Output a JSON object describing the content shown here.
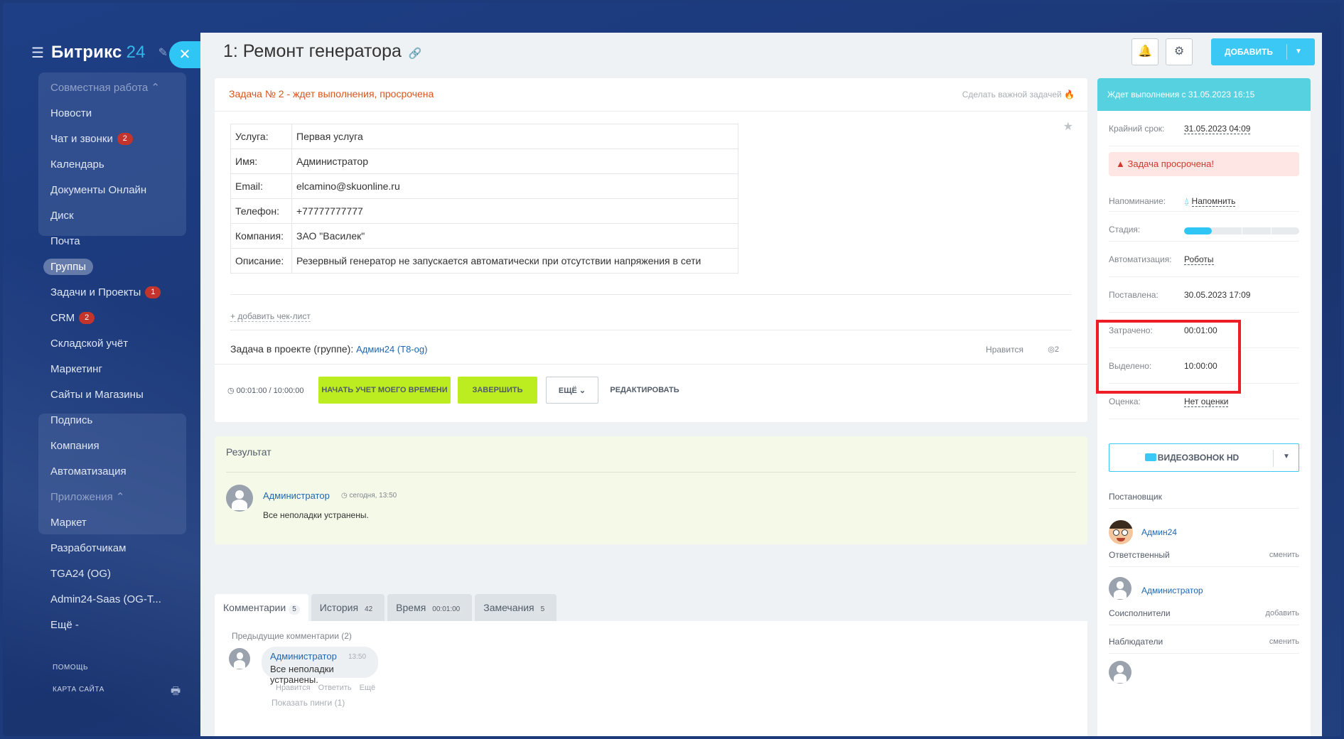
{
  "sidebar": {
    "logo": "Битрикс",
    "logo_num": "24",
    "items": [
      {
        "label": "Совместная работа ⌃",
        "dim": true
      },
      {
        "label": "Новости"
      },
      {
        "label": "Чат и звонки",
        "badge": "2"
      },
      {
        "label": "Календарь"
      },
      {
        "label": "Документы Онлайн"
      },
      {
        "label": "Диск"
      },
      {
        "label": "Почта"
      },
      {
        "label": "Группы",
        "active": true
      },
      {
        "label": "Задачи и Проекты",
        "badge": "1"
      },
      {
        "label": "CRM",
        "badge": "2"
      },
      {
        "label": "Складской учёт"
      },
      {
        "label": "Маркетинг"
      },
      {
        "label": "Сайты и Магазины"
      },
      {
        "label": "Подпись"
      },
      {
        "label": "Компания"
      },
      {
        "label": "Автоматизация"
      },
      {
        "label": "Приложения ⌃",
        "dim": true
      },
      {
        "label": "Маркет"
      },
      {
        "label": "Разработчикам"
      },
      {
        "label": "TGA24 (OG)"
      },
      {
        "label": "Admin24-Saas (OG-T..."
      },
      {
        "label": "Ещё -"
      }
    ],
    "help": "ПОМОЩЬ",
    "sitemap": "КАРТА САЙТА"
  },
  "header": {
    "title": "1: Ремонт генератора",
    "add_label": "ДОБАВИТЬ"
  },
  "task": {
    "status_line": "Задача № 2 - ждет выполнения, просрочена",
    "make_important": "Сделать важной задачей",
    "fields": [
      {
        "k": "Услуга:",
        "v": "Первая услуга"
      },
      {
        "k": "Имя:",
        "v": "Администратор"
      },
      {
        "k": "Email:",
        "v": "elcamino@skuonline.ru"
      },
      {
        "k": "Телефон:",
        "v": "+77777777777"
      },
      {
        "k": "Компания:",
        "v": "ЗАО \"Василек\""
      },
      {
        "k": "Описание:",
        "v": "Резервный генератор не запускается автоматически  при отсутствии напряжения в сети"
      }
    ],
    "add_checklist": "+ добавить чек-лист",
    "in_project": "Задача в проекте (группе):",
    "project_name": "Админ24 (Т8-og)",
    "like": "Нравится",
    "views": "2",
    "timer": "00:01:00 / 10:00:00",
    "btn_start": "НАЧАТЬ УЧЕТ МОЕГО ВРЕМЕНИ",
    "btn_finish": "ЗАВЕРШИТЬ",
    "btn_more": "ЕЩЁ",
    "btn_edit": "РЕДАКТИРОВАТЬ"
  },
  "result": {
    "title": "Результат",
    "author": "Администратор",
    "time": "сегодня, 13:50",
    "text": "Все неполадки устранены."
  },
  "tabs": [
    {
      "label": "Комментарии",
      "count": "5"
    },
    {
      "label": "История",
      "count": "42"
    },
    {
      "label": "Время",
      "count": "00:01:00"
    },
    {
      "label": "Замечания",
      "count": "5"
    }
  ],
  "comments": {
    "prev_label": "Предыдущие комментарии",
    "prev_count": "(2)",
    "author": "Администратор",
    "time": "13:50",
    "text": "Все неполадки устранены.",
    "actions": "Нравится Ответить Ещё",
    "pings": "Показать пинги (1)"
  },
  "right": {
    "status": "Ждет выполнения с 31.05.2023 16:15",
    "deadline_label": "Крайний срок:",
    "deadline": "31.05.2023 04:09",
    "overdue": "Задача просрочена!",
    "reminder_label": "Напоминание:",
    "reminder": "Напомнить",
    "stage_label": "Стадия:",
    "stage_progress": 0.24,
    "automation_label": "Автоматизация:",
    "automation": "Роботы",
    "created_label": "Поставлена:",
    "created": "30.05.2023 17:09",
    "spent_label": "Затрачено:",
    "spent": "00:01:00",
    "allocated_label": "Выделено:",
    "allocated": "10:00:00",
    "rating_label": "Оценка:",
    "rating": "Нет оценки",
    "video": "ВИДЕОЗВОНОК HD",
    "creator_h": "Постановщик",
    "creator": "Админ24",
    "responsible_h": "Ответственный",
    "responsible_act": "сменить",
    "responsible": "Администратор",
    "accomplices_h": "Соисполнители",
    "accomplices_act": "добавить",
    "observers_h": "Наблюдатели",
    "observers_act": "сменить"
  }
}
